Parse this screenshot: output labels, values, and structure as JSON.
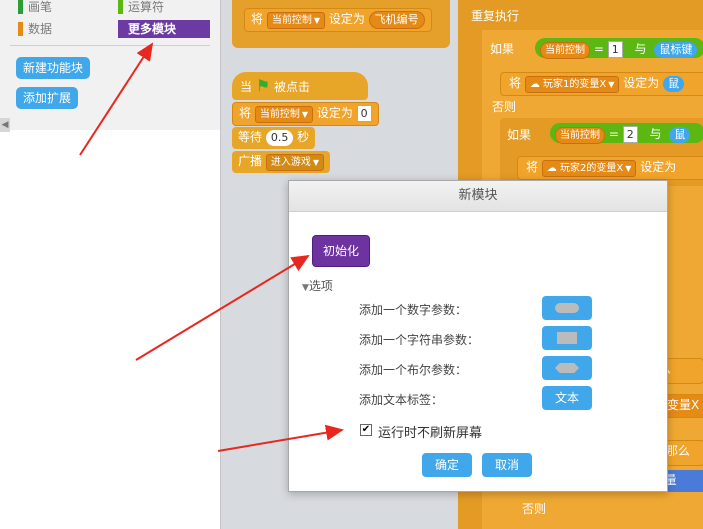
{
  "palette": {
    "categories": [
      {
        "label": "画笔",
        "color": "#2b9d39"
      },
      {
        "label": "运算符",
        "color": "#5cb712"
      },
      {
        "label": "数据",
        "color": "#e68a16"
      },
      {
        "label": "更多模块",
        "color": "#6d3aa3"
      }
    ],
    "make_block_label": "新建功能块",
    "add_extension_label": "添加扩展"
  },
  "scripts": {
    "set_label": "将",
    "set_to_label": "设定为",
    "current_control": "当前控制",
    "plane_number": "飞机编号",
    "repeat_forever": "重复执行",
    "if_label": "如果",
    "and_label": "与",
    "mouse_key": "鼠标键",
    "else_label": "否则",
    "eq": "=",
    "one": "1",
    "two": "2",
    "player1_var": "玩家1的变量X",
    "player2_var": "玩家2的变量X",
    "when_label": "当",
    "clicked_label": "被点击",
    "zero": "0",
    "wait_label": "等待",
    "wait_value": "0.5",
    "seconds": "秒",
    "broadcast_label": "广播",
    "enter_game": "进入游戏",
    "partial_me": "么",
    "partial_var": "的变量X",
    "partial_me2": "那么",
    "partial_var2": "2的变量",
    "else_bottom": "否则"
  },
  "dialog": {
    "title": "新模块",
    "block_name": "初始化",
    "options_label": "选项",
    "add_number": "添加一个数字参数：",
    "add_string": "添加一个字符串参数：",
    "add_boolean": "添加一个布尔参数：",
    "add_text_label": "添加文本标签：",
    "text_btn": "文本",
    "run_without_refresh": "运行时不刷新屏幕",
    "run_without_refresh_checked": true,
    "ok": "确定",
    "cancel": "取消"
  }
}
